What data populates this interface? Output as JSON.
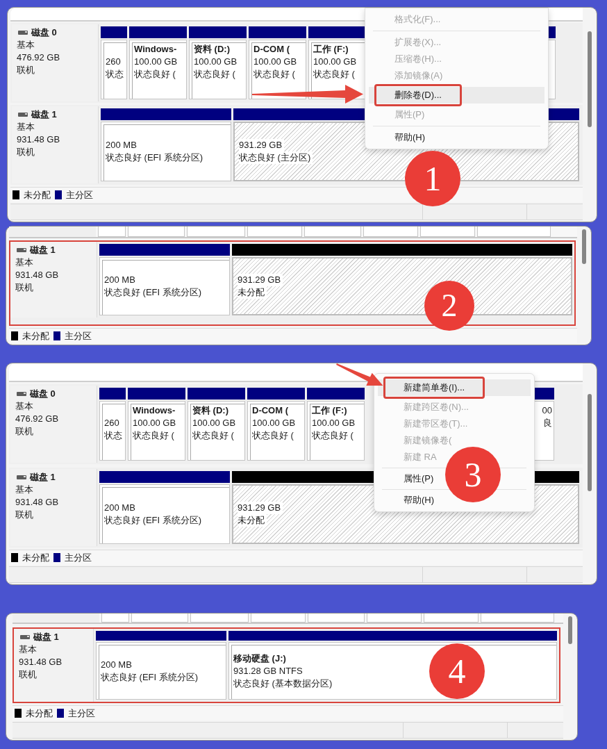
{
  "panels": [
    {
      "badge": "1",
      "scrolled": false,
      "status_bar": true,
      "arrow": {
        "kind": "horizontal"
      },
      "disks": [
        {
          "name": "磁盘 0",
          "type": "基本",
          "size": "476.92 GB",
          "status": "联机",
          "outlined": false,
          "partitions": [
            {
              "kind": "primary",
              "selected": false,
              "lines": [
                "260",
                "状态"
              ]
            },
            {
              "kind": "primary",
              "selected": false,
              "title": "Windows-",
              "lines": [
                "100.00 GB",
                "状态良好 ("
              ]
            },
            {
              "kind": "primary",
              "selected": false,
              "title": "资料 (D:)",
              "lines": [
                "100.00 GB",
                "状态良好 ("
              ]
            },
            {
              "kind": "primary",
              "selected": false,
              "title": "D-COM (",
              "lines": [
                "100.00 GB",
                "状态良好 ("
              ]
            },
            {
              "kind": "primary",
              "selected": false,
              "title": "工作 (F:)",
              "lines": [
                "100.00 GB",
                "状态良好 ("
              ]
            },
            {
              "kind": "primary",
              "selected": false
            }
          ]
        },
        {
          "name": "磁盘 1",
          "type": "基本",
          "size": "931.48 GB",
          "status": "联机",
          "outlined": false,
          "partitions": [
            {
              "kind": "primary",
              "selected": false,
              "lines": [
                "200 MB",
                "状态良好 (EFI 系统分区)"
              ]
            },
            {
              "kind": "primary",
              "selected": true,
              "lines": [
                "931.29 GB",
                "状态良好 (主分区)"
              ]
            }
          ]
        }
      ],
      "legend": [
        {
          "label": "未分配",
          "color": "#000000"
        },
        {
          "label": "主分区",
          "color": "#000080"
        }
      ],
      "menu": {
        "items": [
          {
            "kind": "item",
            "label": "格式化(F)...",
            "disabled": true,
            "selected": false
          },
          {
            "kind": "separator"
          },
          {
            "kind": "item",
            "label": "扩展卷(X)...",
            "disabled": true,
            "selected": false
          },
          {
            "kind": "item",
            "label": "压缩卷(H)...",
            "disabled": true,
            "selected": false
          },
          {
            "kind": "item",
            "label": "添加镜像(A)",
            "disabled": true,
            "selected": false
          },
          {
            "kind": "item",
            "label": "删除卷(D)...",
            "disabled": false,
            "selected": true
          },
          {
            "kind": "item",
            "label": "属性(P)",
            "disabled": true,
            "selected": false
          },
          {
            "kind": "separator"
          },
          {
            "kind": "item",
            "label": "帮助(H)",
            "disabled": false,
            "selected": false
          }
        ]
      }
    },
    {
      "badge": "2",
      "scrolled": true,
      "status_bar": false,
      "disks": [
        {
          "name": "磁盘 1",
          "type": "基本",
          "size": "931.48 GB",
          "status": "联机",
          "outlined": true,
          "partitions": [
            {
              "kind": "primary",
              "selected": false,
              "lines": [
                "200 MB",
                "状态良好 (EFI 系统分区)"
              ]
            },
            {
              "kind": "unallocated",
              "selected": true,
              "lines": [
                "931.29 GB",
                "未分配"
              ]
            }
          ]
        }
      ],
      "legend": [
        {
          "label": "未分配",
          "color": "#000000"
        },
        {
          "label": "主分区",
          "color": "#000080"
        }
      ]
    },
    {
      "badge": "3",
      "scrolled": false,
      "status_bar": true,
      "arrow": {
        "kind": "diagonal"
      },
      "disks": [
        {
          "name": "磁盘 0",
          "type": "基本",
          "size": "476.92 GB",
          "status": "联机",
          "outlined": false,
          "partitions": [
            {
              "kind": "primary",
              "selected": false,
              "lines": [
                "260",
                "状态"
              ]
            },
            {
              "kind": "primary",
              "selected": false,
              "title": "Windows-",
              "lines": [
                "100.00 GB",
                "状态良好 ("
              ]
            },
            {
              "kind": "primary",
              "selected": false,
              "title": "资料 (D:)",
              "lines": [
                "100.00 GB",
                "状态良好 ("
              ]
            },
            {
              "kind": "primary",
              "selected": false,
              "title": "D-COM (",
              "lines": [
                "100.00 GB",
                "状态良好 ("
              ]
            },
            {
              "kind": "primary",
              "selected": false,
              "title": "工作 (F:)",
              "lines": [
                "100.00 GB",
                "状态良好 ("
              ]
            },
            {
              "kind": "primary",
              "selected": false,
              "lines": [
                "00",
                "良"
              ]
            }
          ]
        },
        {
          "name": "磁盘 1",
          "type": "基本",
          "size": "931.48 GB",
          "status": "联机",
          "outlined": false,
          "partitions": [
            {
              "kind": "primary",
              "selected": false,
              "lines": [
                "200 MB",
                "状态良好 (EFI 系统分区)"
              ]
            },
            {
              "kind": "unallocated",
              "selected": true,
              "lines": [
                "931.29 GB",
                "未分配"
              ]
            }
          ]
        }
      ],
      "legend": [
        {
          "label": "未分配",
          "color": "#000000"
        },
        {
          "label": "主分区",
          "color": "#000080"
        }
      ],
      "menu": {
        "items": [
          {
            "kind": "item",
            "label": "新建简单卷(I)...",
            "disabled": false,
            "selected": true
          },
          {
            "kind": "item",
            "label": "新建跨区卷(N)...",
            "disabled": true,
            "selected": false
          },
          {
            "kind": "item",
            "label": "新建带区卷(T)...",
            "disabled": true,
            "selected": false
          },
          {
            "kind": "item",
            "label": "新建镜像卷(",
            "disabled": true,
            "selected": false
          },
          {
            "kind": "item",
            "label": "新建 RA",
            "disabled": true,
            "selected": false
          },
          {
            "kind": "separator"
          },
          {
            "kind": "item",
            "label": "属性(P)",
            "disabled": false,
            "selected": false
          },
          {
            "kind": "separator"
          },
          {
            "kind": "item",
            "label": "帮助(H)",
            "disabled": false,
            "selected": false
          }
        ]
      }
    },
    {
      "badge": "4",
      "scrolled": true,
      "status_bar": true,
      "disks": [
        {
          "name": "磁盘 1",
          "type": "基本",
          "size": "931.48 GB",
          "status": "联机",
          "outlined": true,
          "partitions": [
            {
              "kind": "primary",
              "selected": false,
              "lines": [
                "200 MB",
                "状态良好 (EFI 系统分区)"
              ]
            },
            {
              "kind": "primary",
              "selected": false,
              "title": "移动硬盘 (J:)",
              "lines": [
                "931.28 GB NTFS",
                "状态良好 (基本数据分区)"
              ]
            }
          ]
        }
      ],
      "legend": [
        {
          "label": "未分配",
          "color": "#000000"
        },
        {
          "label": "主分区",
          "color": "#000080"
        }
      ]
    }
  ]
}
